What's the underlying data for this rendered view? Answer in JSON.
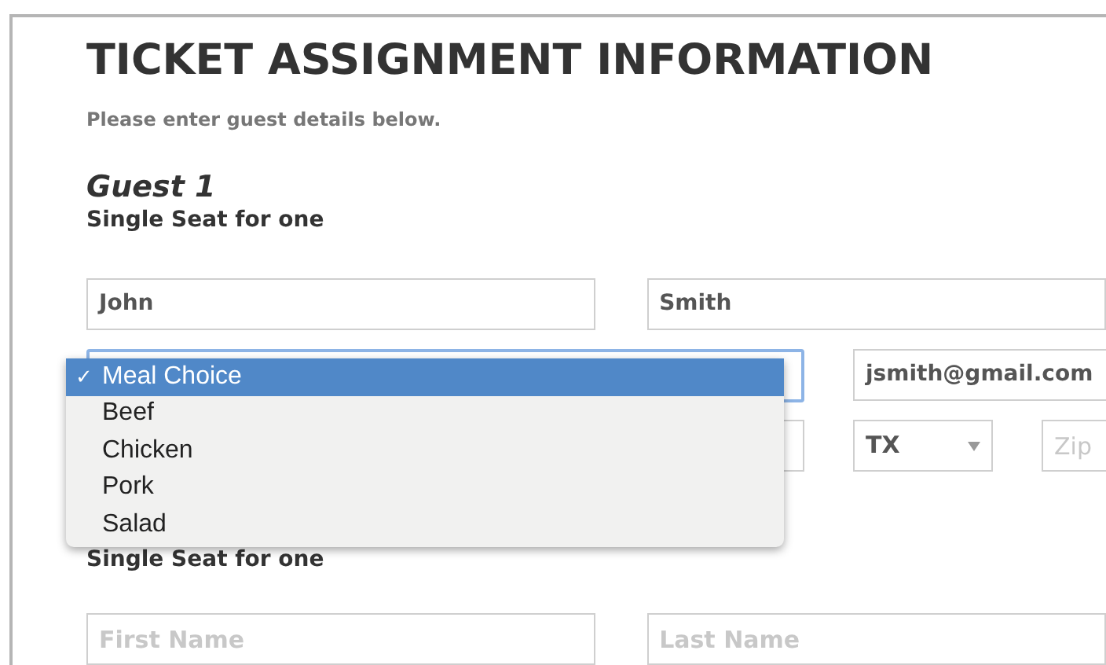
{
  "title": "TICKET ASSIGNMENT INFORMATION",
  "subtitle": "Please enter guest details below.",
  "guest": {
    "heading": "Guest 1",
    "seat": "Single Seat for one"
  },
  "fields": {
    "first_name": {
      "value": "John"
    },
    "last_name": {
      "value": "Smith"
    },
    "email": {
      "value": "jsmith@gmail.com"
    },
    "state": {
      "value": "TX"
    },
    "zip": {
      "placeholder": "Zip"
    }
  },
  "meal_menu": {
    "check_mark": "✓",
    "options": [
      {
        "label": "Meal Choice",
        "selected": true
      },
      {
        "label": "Beef",
        "selected": false
      },
      {
        "label": "Chicken",
        "selected": false
      },
      {
        "label": "Pork",
        "selected": false
      },
      {
        "label": "Salad",
        "selected": false
      }
    ]
  },
  "guest_2": {
    "seat": "Single Seat for one",
    "first_name": {
      "placeholder": "First Name"
    },
    "last_name": {
      "placeholder": "Last Name"
    }
  }
}
